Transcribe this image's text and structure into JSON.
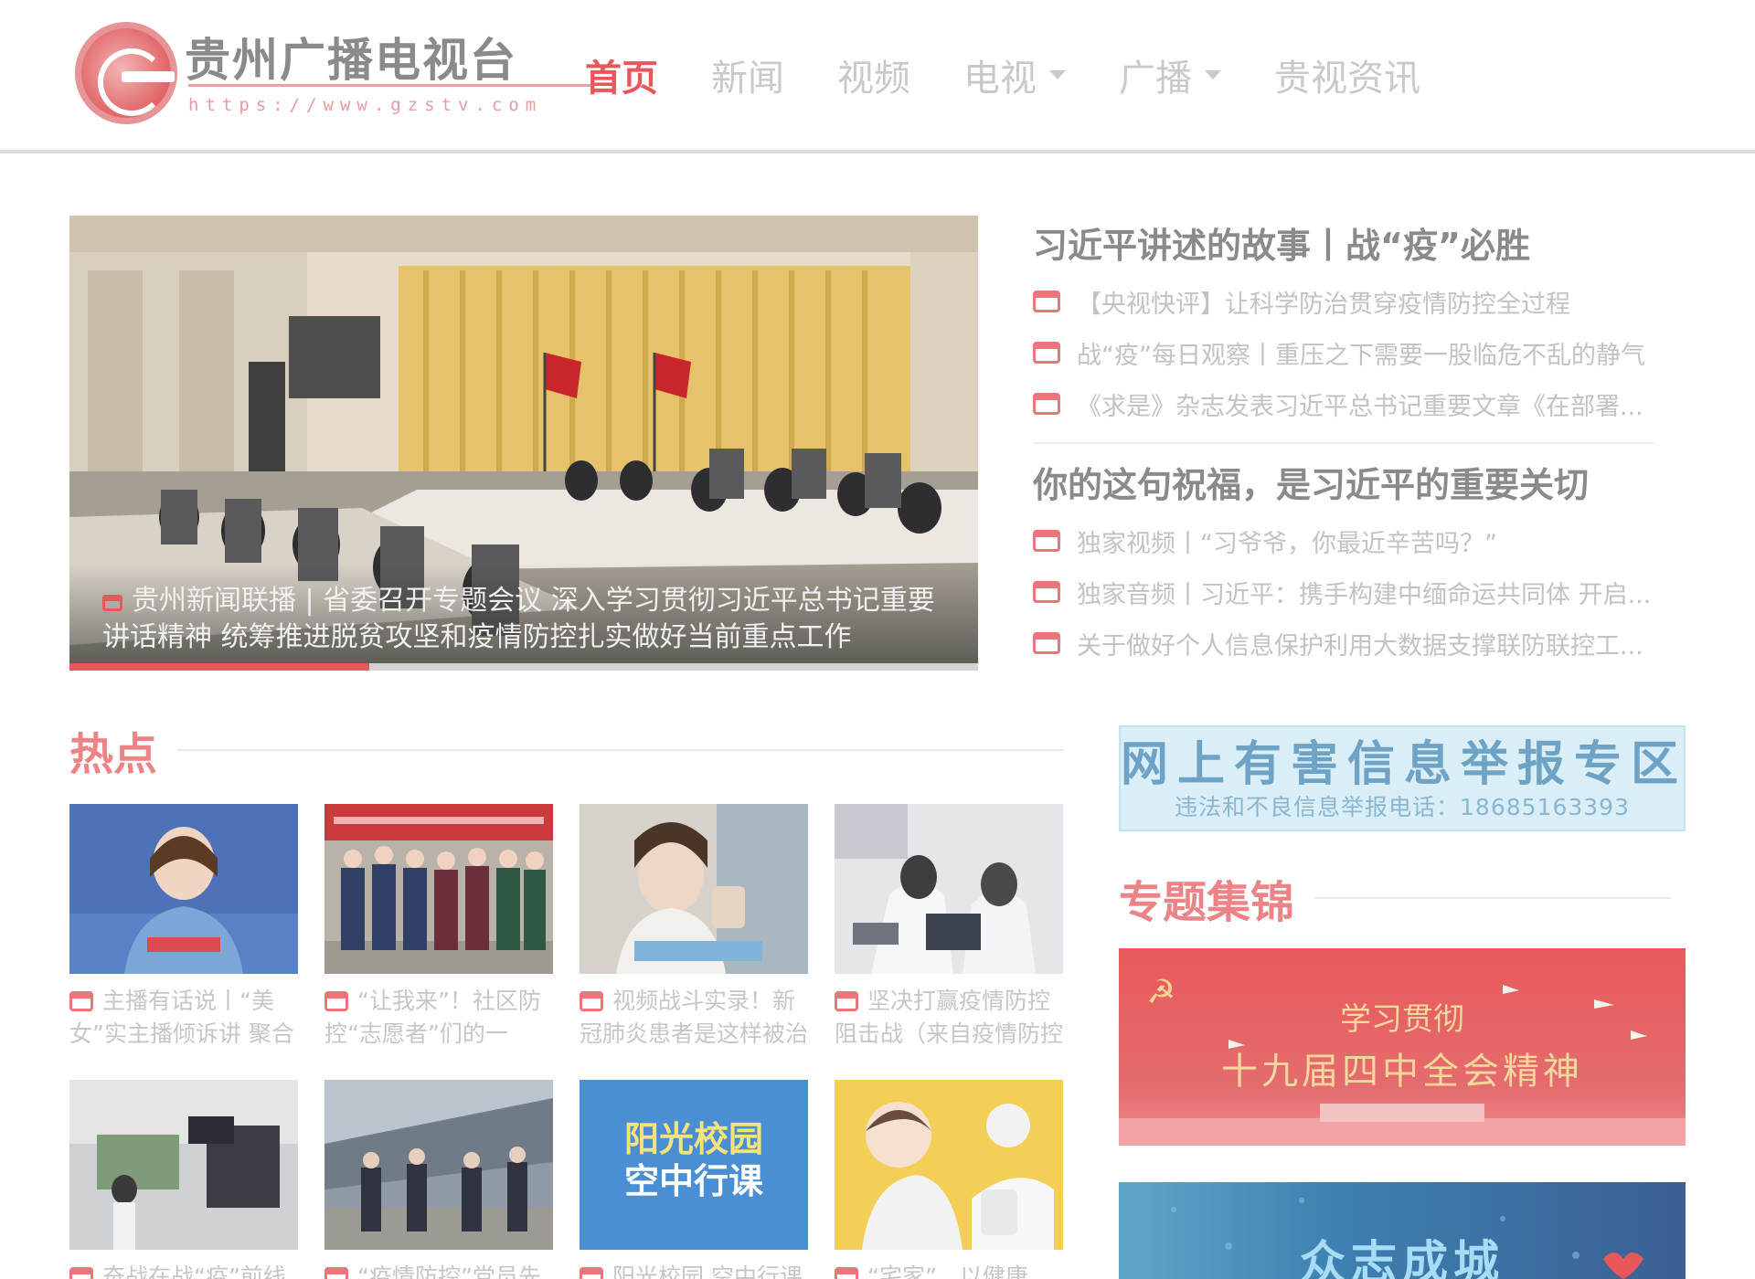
{
  "header": {
    "logo_name": "贵州广播电视台",
    "logo_url": "https://www.gzstv.com",
    "nav": [
      {
        "label": "首页",
        "active": true,
        "dropdown": false
      },
      {
        "label": "新闻",
        "active": false,
        "dropdown": false
      },
      {
        "label": "视频",
        "active": false,
        "dropdown": false
      },
      {
        "label": "电视",
        "active": false,
        "dropdown": true
      },
      {
        "label": "广播",
        "active": false,
        "dropdown": true
      },
      {
        "label": "贵视资讯",
        "active": false,
        "dropdown": false
      }
    ]
  },
  "hero": {
    "caption": "贵州新闻联播 | 省委召开专题会议 深入学习贯彻习近平总书记重要讲话精神 统筹推进脱贫攻坚和疫情防控扎实做好当前重点工作",
    "slide_progress": 0.33
  },
  "headlines": [
    {
      "title": "习近平讲述的故事丨战“疫”必胜",
      "items": [
        "【央视快评】让科学防治贯穿疫情防控全过程",
        "战“疫”每日观察丨重压之下需要一股临危不乱的静气",
        "《求是》杂志发表习近平总书记重要文章《在部署..."
      ]
    },
    {
      "title": "你的这句祝福，是习近平的重要关切",
      "items": [
        "独家视频丨“习爷爷，你最近辛苦吗？”",
        "独家音频丨习近平：携手构建中缅命运共同体 开启...",
        "关于做好个人信息保护利用大数据支撑联防联控工..."
      ]
    }
  ],
  "hot": {
    "title": "热点",
    "cards": [
      {
        "text": "主播有话说丨“美女”实主播倾诉讲 聚合力量同心战“疫”",
        "thumb": "news-anchor"
      },
      {
        "text": "“让我来”！社区防控“志愿者”们的一天，大年...",
        "thumb": "volunteers-group"
      },
      {
        "text": "视频战斗实录！新冠肺炎患者是这样被治愈的",
        "thumb": "nurse-thumbsup"
      },
      {
        "text": "坚决打赢疫情防控阻击战（来自疫情防控一线）",
        "thumb": "lab-workers"
      },
      {
        "text": "奋战在战“疫”前线",
        "thumb": "camera-crew"
      },
      {
        "text": "“疫情防控”党员先锋队",
        "thumb": "inspection-team"
      },
      {
        "text": "阳光校园 空中行课",
        "thumb": "sunshine-campus"
      },
      {
        "text": "“宅家”，以健康...",
        "thumb": "cartoon-illustration"
      }
    ],
    "thumb_labels": {
      "sunshine_campus_line1": "阳光校园",
      "sunshine_campus_line2": "空中行课"
    }
  },
  "sidebar": {
    "report": {
      "title": "网上有害信息举报专区",
      "subtitle": "违法和不良信息举报电话：18685163393"
    },
    "topics_title": "专题集锦",
    "banner_red": {
      "line1": "学习贯彻",
      "line2": "十九届四中全会精神"
    },
    "banner_blue": {
      "text": "众志成城"
    }
  },
  "colors": {
    "accent": "#e8585b",
    "nav_inactive": "#c9c9c9",
    "report_bg": "#d9eef7"
  }
}
